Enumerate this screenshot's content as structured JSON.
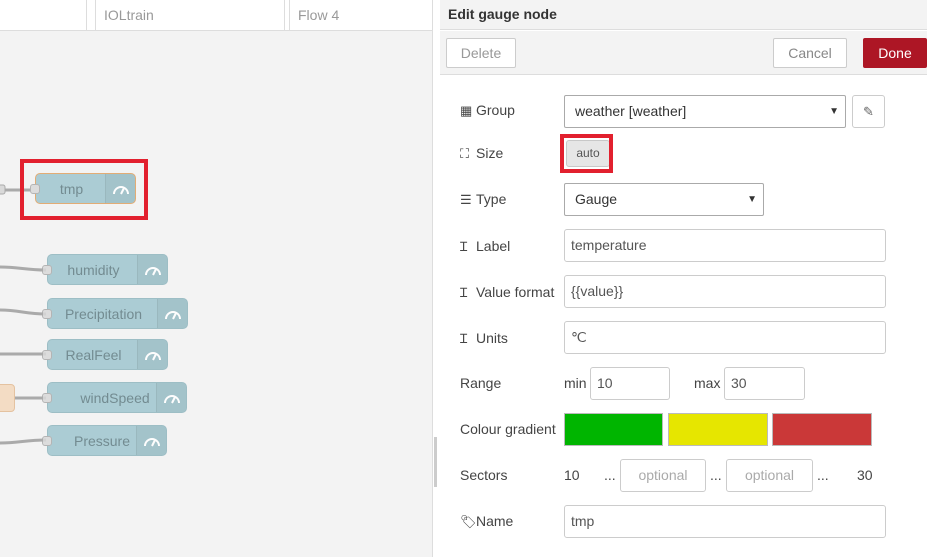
{
  "workspace": {
    "tabs": [
      "",
      "IOLtrain",
      "Flow 4"
    ],
    "nodes": [
      {
        "label": "tmp",
        "icon": "gauge-icon"
      },
      {
        "label": "humidity",
        "icon": "gauge-icon"
      },
      {
        "label": "Precipitation",
        "icon": "gauge-icon"
      },
      {
        "label": "RealFeel",
        "icon": "gauge-icon"
      },
      {
        "label": "windSpeed",
        "icon": "gauge-icon"
      },
      {
        "label": "Pressure",
        "icon": "gauge-icon"
      }
    ],
    "highlight_color": "#e2202e"
  },
  "tray": {
    "title": "Edit gauge node",
    "delete_label": "Delete",
    "cancel_label": "Cancel",
    "done_label": "Done",
    "done_color": "#ad1625",
    "fields": {
      "group": {
        "label": "Group",
        "icon": "table-icon",
        "value": "weather [weather]",
        "edit_icon": "pencil-icon"
      },
      "size": {
        "label": "Size",
        "icon": "resize-icon",
        "value": "auto"
      },
      "type": {
        "label": "Type",
        "icon": "list-icon",
        "value": "Gauge"
      },
      "label": {
        "label": "Label",
        "icon": "text-cursor-icon",
        "value": "temperature"
      },
      "value_format": {
        "label": "Value format",
        "icon": "text-cursor-icon",
        "value": "{{value}}"
      },
      "units": {
        "label": "Units",
        "icon": "text-cursor-icon",
        "value": "℃"
      },
      "range": {
        "label": "Range",
        "min_label": "min",
        "min_value": "10",
        "max_label": "max",
        "max_value": "30"
      },
      "colour_gradient": {
        "label": "Colour gradient",
        "colors": [
          "#00b500",
          "#e6e600",
          "#ca3838"
        ]
      },
      "sectors": {
        "label": "Sectors",
        "start": "10",
        "dots": "...",
        "placeholder1": "optional",
        "placeholder2": "optional",
        "end": "30"
      },
      "name": {
        "label": "Name",
        "icon": "tag-icon",
        "value": "tmp"
      }
    }
  }
}
